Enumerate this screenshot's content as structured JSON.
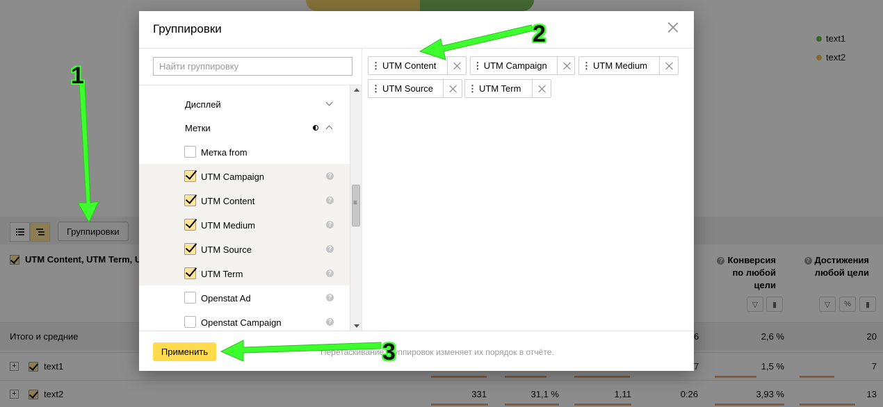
{
  "legend": [
    {
      "label": "text1",
      "color": "#6cb84c"
    },
    {
      "label": "text2",
      "color": "#e8c24a"
    }
  ],
  "toolbar": {
    "groupings_button": "Группировки"
  },
  "report": {
    "first_column_header": "UTM Content, UTM Term, U",
    "col_conversion": [
      "Конверсия",
      "по любой",
      "цели"
    ],
    "col_goals": [
      "Достижения",
      "любой цели"
    ],
    "total_label": "Итого и средние",
    "total_values": {
      "v_avg_time_partial": "6",
      "conversion": "2,6 %",
      "goals": "20"
    },
    "rows": [
      {
        "label": "text1",
        "v_avg_time_partial": "7",
        "conversion": "1,5 %",
        "goals": "7"
      },
      {
        "label": "text2",
        "visits": "331",
        "bounce": "31,1 %",
        "depth": "1,11",
        "time": "0:26",
        "conversion": "3,93 %",
        "goals": "13"
      }
    ]
  },
  "modal": {
    "title": "Группировки",
    "search_placeholder": "Найти группировку",
    "sections": {
      "display": "Дисплей",
      "tags": "Метки"
    },
    "items": [
      {
        "label": "Метка from",
        "checked": false
      },
      {
        "label": "UTM Campaign",
        "checked": true
      },
      {
        "label": "UTM Content",
        "checked": true
      },
      {
        "label": "UTM Medium",
        "checked": true
      },
      {
        "label": "UTM Source",
        "checked": true
      },
      {
        "label": "UTM Term",
        "checked": true
      },
      {
        "label": "Openstat Ad",
        "checked": false
      },
      {
        "label": "Openstat Campaign",
        "checked": false
      }
    ],
    "selected_chips": [
      "UTM Content",
      "UTM Campaign",
      "UTM Medium",
      "UTM Source",
      "UTM Term"
    ],
    "apply_button": "Применить",
    "hint": "Перетаскивание группировок изменяет их порядок в отчёте."
  },
  "annotations": {
    "step1": "1",
    "step2": "2",
    "step3": "3",
    "color": "#3dff2e"
  }
}
